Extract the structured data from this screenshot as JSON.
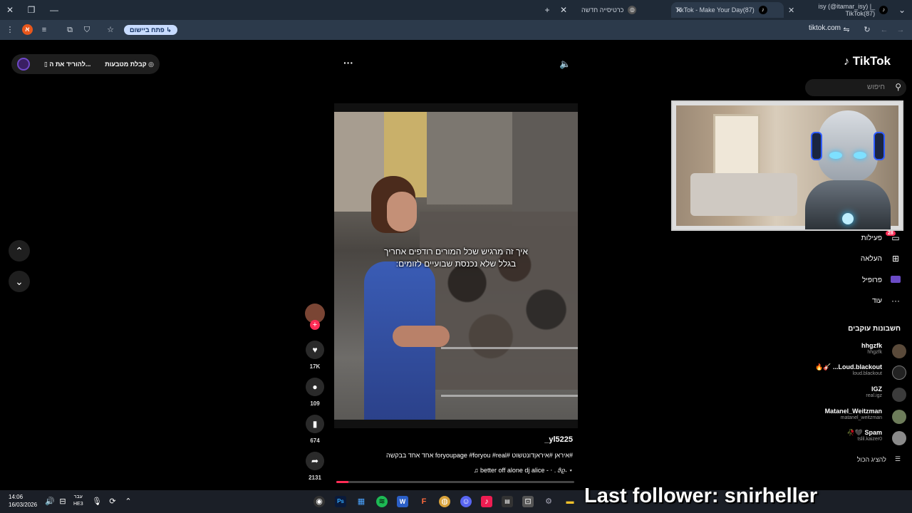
{
  "browser": {
    "tabs": [
      {
        "label": "_isy (@itamar_isy) | TikTok(87)",
        "icon": "tiktok-icon"
      },
      {
        "label": "(87)TikTok - Make Your Day",
        "icon": "tiktok-icon"
      },
      {
        "label": "כרטיסייה חדשה",
        "icon": "chrome-icon"
      }
    ],
    "new_tab": "+",
    "open_app_label": "פתח ביישום",
    "url": "tiktok.com"
  },
  "tiktok": {
    "logo": "TikTok",
    "search_placeholder": "חיפוש",
    "download_pill": {
      "download_label": "להוריד את ה...",
      "coins_label": "קבלת מטבעות"
    },
    "top_more": "···",
    "nav": [
      {
        "label": "פעילות",
        "icon": "inbox-icon"
      },
      {
        "label": "העלאה",
        "icon": "upload-icon"
      },
      {
        "label": "פרופיל",
        "icon": "profile-icon"
      },
      {
        "label": "עוד",
        "icon": "more-icon"
      }
    ],
    "activity_badge": "28",
    "following_title": "חשבונות עוקבים",
    "following": [
      {
        "name": "hhgzfk",
        "handle": "hhgzfk"
      },
      {
        "name": "...Loud.blackout",
        "handle": "loud.blackout"
      },
      {
        "name": "IGZ",
        "handle": "real.igz"
      },
      {
        "name": "Matanel_Weitzman",
        "handle": "matanel_weitzman"
      },
      {
        "name": "Spam",
        "handle": "tslil.kaizer0"
      }
    ],
    "show_all": "להציג הכול",
    "video": {
      "caption_line1": "איך זה מרגיש שכל המורים רודפים אחריך",
      "caption_line2": "בגלל שלא נכנסת שבועיים לזומים:",
      "username": "_yl5225",
      "description": "#איראן #איראןדונטשוט #foryoupage #foryou #real אחד אחד בבקשה",
      "music": "♫ better off alone dj alice - ⋅ . 𝜗𝜚˖ ⋆",
      "progress": 0.05
    },
    "actions": {
      "likes": "17K",
      "comments": "109",
      "saves": "674",
      "shares": "2131"
    }
  },
  "taskbar": {
    "time": "14:06",
    "date": "16/03/2026",
    "lang_line1": "עבר",
    "lang_line2": "HE3"
  },
  "overlay": {
    "text": "Last follower: snirheller"
  }
}
